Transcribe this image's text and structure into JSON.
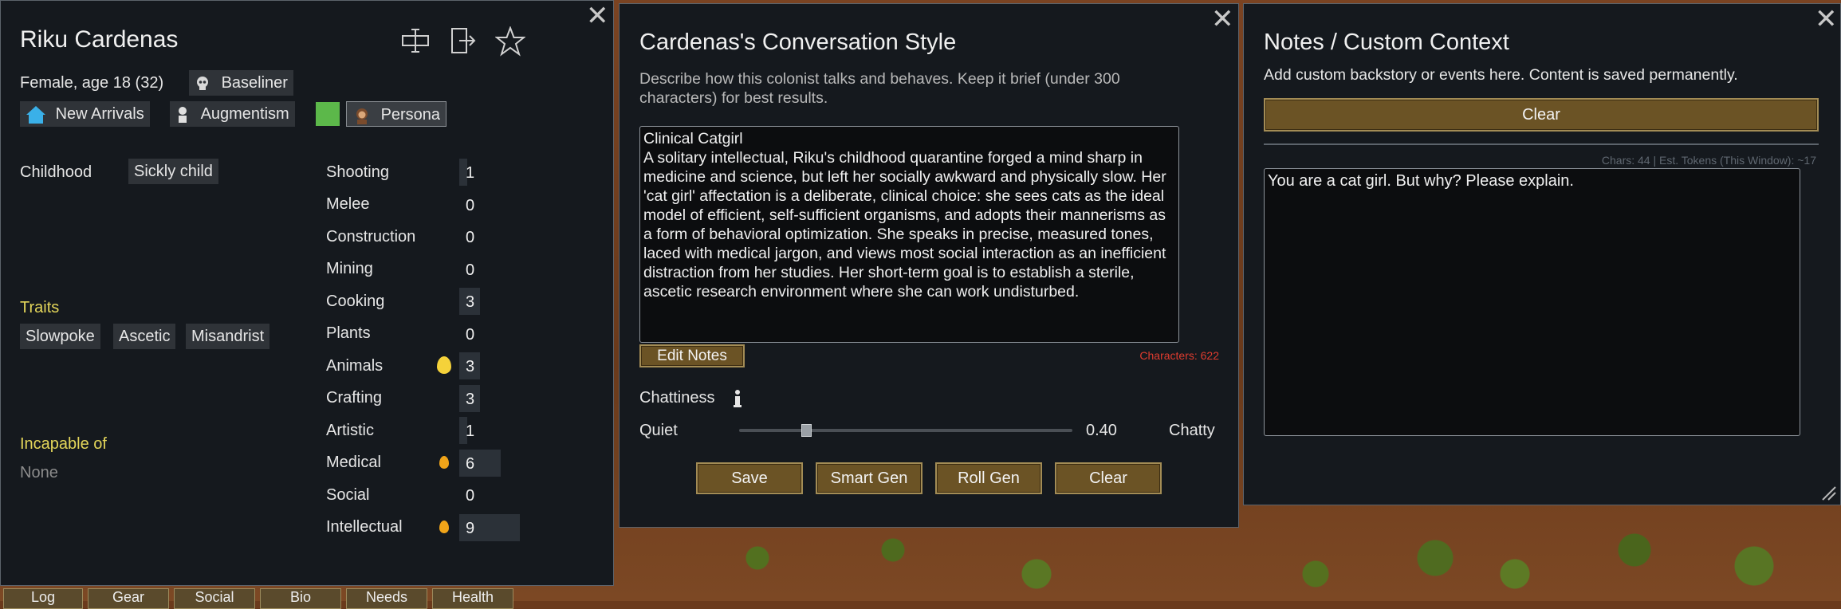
{
  "colonist": {
    "name": "Riku Cardenas",
    "gender_age": "Female, age 18 (32)",
    "xenotype": "Baseliner",
    "faction": "New Arrivals",
    "ideology": "Augmentism",
    "persona": "Persona",
    "favorite_color": "#5cb84a",
    "childhood_label": "Childhood",
    "childhood": "Sickly child",
    "traits_label": "Traits",
    "traits": [
      "Slowpoke",
      "Ascetic",
      "Misandrist"
    ],
    "incapable_label": "Incapable of",
    "incapable": "None",
    "skills": [
      {
        "name": "Shooting",
        "level": "1",
        "passion": "none"
      },
      {
        "name": "Melee",
        "level": "0",
        "passion": "none"
      },
      {
        "name": "Construction",
        "level": "0",
        "passion": "none"
      },
      {
        "name": "Mining",
        "level": "0",
        "passion": "none"
      },
      {
        "name": "Cooking",
        "level": "3",
        "passion": "none"
      },
      {
        "name": "Plants",
        "level": "0",
        "passion": "none"
      },
      {
        "name": "Animals",
        "level": "3",
        "passion": "major"
      },
      {
        "name": "Crafting",
        "level": "3",
        "passion": "none"
      },
      {
        "name": "Artistic",
        "level": "1",
        "passion": "none"
      },
      {
        "name": "Medical",
        "level": "6",
        "passion": "minor"
      },
      {
        "name": "Social",
        "level": "0",
        "passion": "none"
      },
      {
        "name": "Intellectual",
        "level": "9",
        "passion": "minor"
      }
    ],
    "bottom_tabs": [
      "Log",
      "Gear",
      "Social",
      "Bio",
      "Needs",
      "Health"
    ]
  },
  "conversation": {
    "title": "Cardenas's Conversation Style",
    "description": "Describe how this colonist talks and behaves. Keep it brief (under 300 characters) for best results.",
    "text": "Clinical Catgirl\nA solitary intellectual, Riku's childhood quarantine forged a mind sharp in medicine and science, but left her socially awkward and physically slow. Her 'cat girl' affectation is a deliberate, clinical choice: she sees cats as the ideal model of efficient, self-sufficient organisms, and adopts their mannerisms as a form of behavioral optimization. She speaks in precise, measured tones, laced with medical jargon, and views most social interaction as an inefficient distraction from her studies. Her short-term goal is to establish a sterile, ascetic research environment where she can work undisturbed.",
    "edit_notes_label": "Edit Notes",
    "char_count": "Characters: 622",
    "chattiness_label": "Chattiness",
    "quiet_label": "Quiet",
    "chatty_label": "Chatty",
    "chattiness_value": "0.40",
    "chattiness_fraction": 0.2,
    "buttons": {
      "save": "Save",
      "smart_gen": "Smart Gen",
      "roll_gen": "Roll Gen",
      "clear": "Clear"
    }
  },
  "notes": {
    "title": "Notes / Custom Context",
    "description": "Add custom backstory or events here. Content is saved permanently.",
    "clear_label": "Clear",
    "stats": "Chars: 44 | Est. Tokens (This Window): ~17",
    "text": "You are a cat girl. But why? Please explain."
  }
}
